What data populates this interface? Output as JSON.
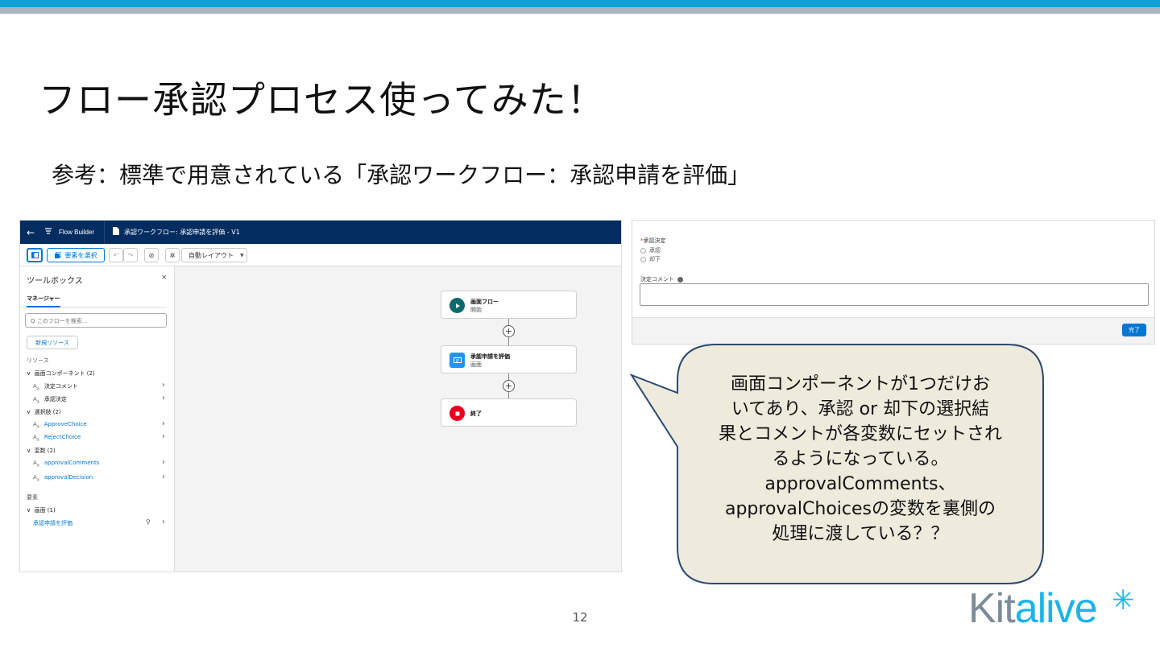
{
  "slide": {
    "title": "フロー承認プロセス使ってみた！",
    "subtitle": "参考：標準で用意されている「承認ワークフロー：承認申請を評価」",
    "page_number": "12",
    "logo_text_a": "Kit",
    "logo_text_b": "alive",
    "logo_star": "✳"
  },
  "colors": {
    "accent_bar": "#0aa0d8",
    "header_navy": "#032d60",
    "brand_blue": "#0176d3",
    "callout_fill": "#eeeadc",
    "callout_border": "#2b4a70"
  },
  "flow_builder": {
    "header": {
      "back_icon": "←",
      "app_icon": "flow-icon",
      "app_name": "Flow Builder",
      "tab_label": "承認ワークフロー: 承認申請を評価 - V1"
    },
    "toolbar": {
      "select_label": "要素を選択",
      "undo": "↶",
      "redo": "↷",
      "debug": "⊘",
      "settings": "✲",
      "layout_label": "自動レイアウト",
      "layout_caret": "▼"
    },
    "sidebar": {
      "title": "ツールボックス",
      "close": "×",
      "tab": "マネージャー",
      "search_placeholder": "Q このフローを検索...",
      "new_resource": "新規リソース",
      "resources_heading": "リソース",
      "screen_components": "画面コンポーネント (2)",
      "comp_1": "決定コメント",
      "comp_2": "承認決定",
      "choices": "選択肢 (2)",
      "choice_1": "ApproveChoice",
      "choice_2": "RejectChoice",
      "variables": "変数 (2)",
      "var_1": "approvalComments",
      "var_2": "approvalDecision",
      "elements_heading": "要素",
      "screens": "画面 (1)",
      "screen_1": "承認申請を評価",
      "type_letter": "A",
      "type_sub": "a",
      "expand": "∨",
      "chevron": "›",
      "magnifier": "⚲"
    },
    "canvas": {
      "start_title": "画面フロー",
      "start_sub": "開始",
      "screen_title": "承認申請を評価",
      "screen_sub": "画面",
      "end_title": "終了",
      "plus": "+"
    }
  },
  "screen_preview": {
    "required_mark": "*",
    "decision_label": "承認決定",
    "option_approve": "承認",
    "option_reject": "却下",
    "comment_label": "決定コメント",
    "done_button": "完了"
  },
  "callout": {
    "line1": "画面コンポーネントが1つだけお",
    "line2": "いてあり、承認 or 却下の選択結",
    "line3": "果とコメントが各変数にセットされ",
    "line4": "るようになっている。",
    "line5": "approvalComments、",
    "line6": "approvalChoicesの変数を裏側の",
    "line7": "処理に渡している？？"
  }
}
